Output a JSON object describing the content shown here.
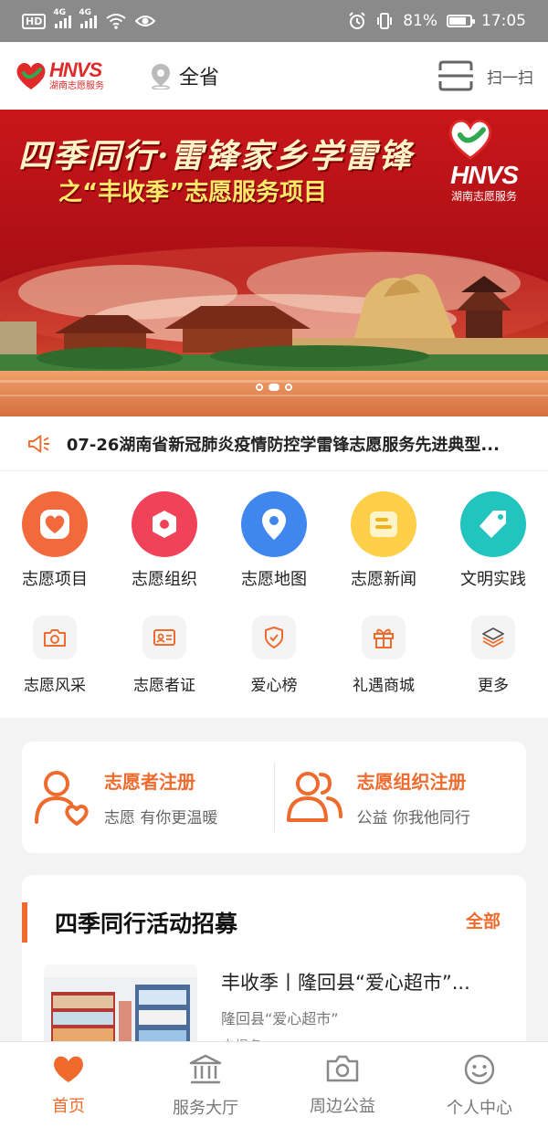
{
  "status_bar": {
    "network_1": "4G",
    "network_2": "4G",
    "battery_percent": "81%",
    "battery_level": 0.81,
    "time": "17:05",
    "hd_label": "HD"
  },
  "header": {
    "logo_text": "HNVS",
    "logo_subtitle": "湖南志愿服务",
    "location": "全省",
    "scan_label": "扫一扫"
  },
  "banner": {
    "title": "四季同行·雷锋家乡学雷锋",
    "subtitle": "之“丰收季”志愿服务项目",
    "logo_text": "HNVS",
    "logo_subtitle": "湖南志愿服务",
    "slide_count": 3,
    "active_slide": 2
  },
  "notice": {
    "text": "07-26湖南省新冠肺炎疫情防控学雷锋志愿服务先进典型..."
  },
  "primary_menu": [
    {
      "label": "志愿项目",
      "icon": "heart-icon",
      "color": "#f26a3c"
    },
    {
      "label": "志愿组织",
      "icon": "hexagon-icon",
      "color": "#f0435a"
    },
    {
      "label": "志愿地图",
      "icon": "map-pin-icon",
      "color": "#3f86ee"
    },
    {
      "label": "志愿新闻",
      "icon": "news-icon",
      "color": "#ffcf4a"
    },
    {
      "label": "文明实践",
      "icon": "tag-icon",
      "color": "#22c4c0"
    }
  ],
  "secondary_menu": [
    {
      "label": "志愿风采",
      "icon": "camera-icon"
    },
    {
      "label": "志愿者证",
      "icon": "id-card-icon"
    },
    {
      "label": "爱心榜",
      "icon": "shield-check-icon"
    },
    {
      "label": "礼遇商城",
      "icon": "gift-icon"
    },
    {
      "label": "更多",
      "icon": "layers-icon"
    }
  ],
  "registration": {
    "volunteer": {
      "title": "志愿者注册",
      "desc": "志愿 有你更温暖"
    },
    "organization": {
      "title": "志愿组织注册",
      "desc": "公益 你我他同行"
    }
  },
  "activities": {
    "title": "四季同行活动招募",
    "all_label": "全部",
    "items": [
      {
        "name": "丰收季丨隆回县“爱心超市”...",
        "sub": "隆回县“爱心超市”",
        "status": "未报名"
      }
    ]
  },
  "tabbar": [
    {
      "label": "首页",
      "icon": "home-heart-icon",
      "active": true
    },
    {
      "label": "服务大厅",
      "icon": "bank-icon",
      "active": false
    },
    {
      "label": "周边公益",
      "icon": "camera-icon",
      "active": false
    },
    {
      "label": "个人中心",
      "icon": "smile-icon",
      "active": false
    }
  ],
  "colors": {
    "accent": "#ee6b2d",
    "brand_red": "#e02a2a",
    "banner_red": "#b8151a"
  }
}
